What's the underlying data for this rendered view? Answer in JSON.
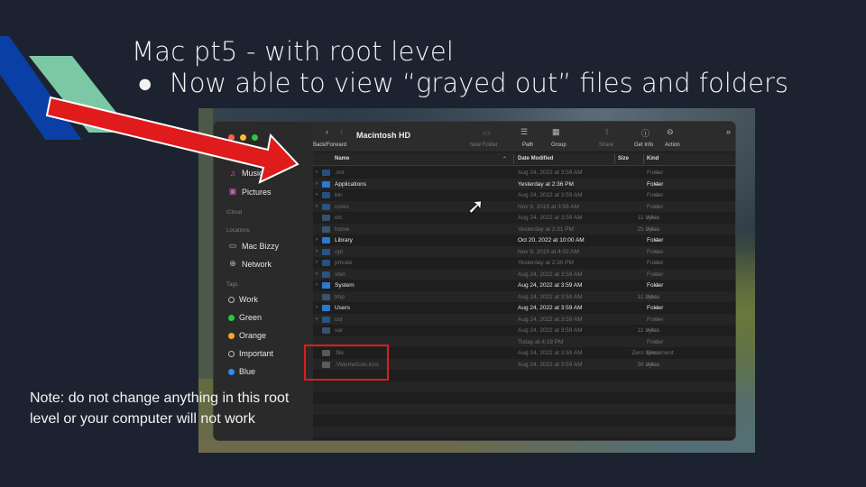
{
  "slide": {
    "title": "Mac pt5 - with root level",
    "bullet_symbol": "●",
    "bullet": "Now able to view “grayed out” files and folders",
    "note": "Note: do not change anything in this root level or your computer will not work",
    "arrow_color": "#e01b1b",
    "highlight_color": "#e01b1b"
  },
  "finder": {
    "window_title": "Macintosh HD",
    "toolbar": {
      "back_forward": "Back/Forward",
      "new_folder": "New Folder",
      "path": "Path",
      "group": "Group",
      "share": "Share",
      "get_info": "Get Info",
      "action": "Action",
      "more": "»"
    },
    "sidebar": {
      "items_top": [
        {
          "label": "Music",
          "icon": "music-note-icon"
        },
        {
          "label": "Pictures",
          "icon": "pictures-icon"
        }
      ],
      "icloud_header": "iCloud",
      "locations_header": "Locations",
      "locations": [
        {
          "label": "Mac Bizzy",
          "icon": "laptop-icon"
        },
        {
          "label": "Network",
          "icon": "globe-icon"
        }
      ],
      "tags_header": "Tags",
      "tags": [
        {
          "label": "Work",
          "color": "none"
        },
        {
          "label": "Green",
          "color": "#28c840"
        },
        {
          "label": "Orange",
          "color": "#f5a623"
        },
        {
          "label": "Important",
          "color": "none"
        },
        {
          "label": "Blue",
          "color": "#2f8cf0"
        }
      ]
    },
    "columns": {
      "name": "Name",
      "date": "Date Modified",
      "size": "Size",
      "kind": "Kind"
    },
    "rows": [
      {
        "name": ".vol",
        "date": "Aug 24, 2022 at 3:59 AM",
        "size": "--",
        "kind": "Folder",
        "dim": true,
        "chev": true,
        "icon": "folder"
      },
      {
        "name": "Applications",
        "date": "Yesterday at 2:36 PM",
        "size": "--",
        "kind": "Folder",
        "dim": false,
        "chev": true,
        "icon": "folder"
      },
      {
        "name": "bin",
        "date": "Aug 24, 2022 at 3:59 AM",
        "size": "--",
        "kind": "Folder",
        "dim": true,
        "chev": true,
        "icon": "folder"
      },
      {
        "name": "cores",
        "date": "Nov 9, 2019 at 3:58 AM",
        "size": "--",
        "kind": "Folder",
        "dim": true,
        "chev": true,
        "icon": "folder"
      },
      {
        "name": "etc",
        "date": "Aug 24, 2022 at 3:59 AM",
        "size": "11 bytes",
        "kind": "Alias",
        "dim": true,
        "chev": false,
        "icon": "alias"
      },
      {
        "name": "home",
        "date": "Yesterday at 2:31 PM",
        "size": "25 bytes",
        "kind": "Alias",
        "dim": true,
        "chev": false,
        "icon": "alias"
      },
      {
        "name": "Library",
        "date": "Oct 20, 2022 at 10:00 AM",
        "size": "--",
        "kind": "Folder",
        "dim": false,
        "chev": true,
        "icon": "folder"
      },
      {
        "name": "opt",
        "date": "Nov 9, 2019 at 4:02 AM",
        "size": "--",
        "kind": "Folder",
        "dim": true,
        "chev": true,
        "icon": "folder"
      },
      {
        "name": "private",
        "date": "Yesterday at 2:30 PM",
        "size": "--",
        "kind": "Folder",
        "dim": true,
        "chev": true,
        "icon": "folder"
      },
      {
        "name": "sbin",
        "date": "Aug 24, 2022 at 3:59 AM",
        "size": "--",
        "kind": "Folder",
        "dim": true,
        "chev": true,
        "icon": "folder"
      },
      {
        "name": "System",
        "date": "Aug 24, 2022 at 3:59 AM",
        "size": "--",
        "kind": "Folder",
        "dim": false,
        "chev": true,
        "icon": "folder"
      },
      {
        "name": "tmp",
        "date": "Aug 24, 2022 at 3:59 AM",
        "size": "11 bytes",
        "kind": "Alias",
        "dim": true,
        "chev": false,
        "icon": "alias"
      },
      {
        "name": "Users",
        "date": "Aug 24, 2022 at 3:59 AM",
        "size": "--",
        "kind": "Folder",
        "dim": false,
        "chev": true,
        "icon": "folder"
      },
      {
        "name": "usr",
        "date": "Aug 24, 2022 at 3:59 AM",
        "size": "--",
        "kind": "Folder",
        "dim": true,
        "chev": true,
        "icon": "folder"
      },
      {
        "name": "var",
        "date": "Aug 24, 2022 at 3:59 AM",
        "size": "11 bytes",
        "kind": "Alias",
        "dim": true,
        "chev": false,
        "icon": "alias"
      },
      {
        "name": "",
        "date": "Today at 4:18 PM",
        "size": "--",
        "kind": "Folder",
        "dim": true,
        "chev": false,
        "icon": "none"
      },
      {
        "name": ".file",
        "date": "Aug 24, 2022 at 3:59 AM",
        "size": "Zero bytes",
        "kind": "Document",
        "dim": true,
        "chev": false,
        "icon": "file"
      },
      {
        "name": ".VolumeIcon.icns",
        "date": "Aug 24, 2022 at 3:59 AM",
        "size": "36 bytes",
        "kind": "Alias",
        "dim": true,
        "chev": false,
        "icon": "file"
      }
    ]
  }
}
